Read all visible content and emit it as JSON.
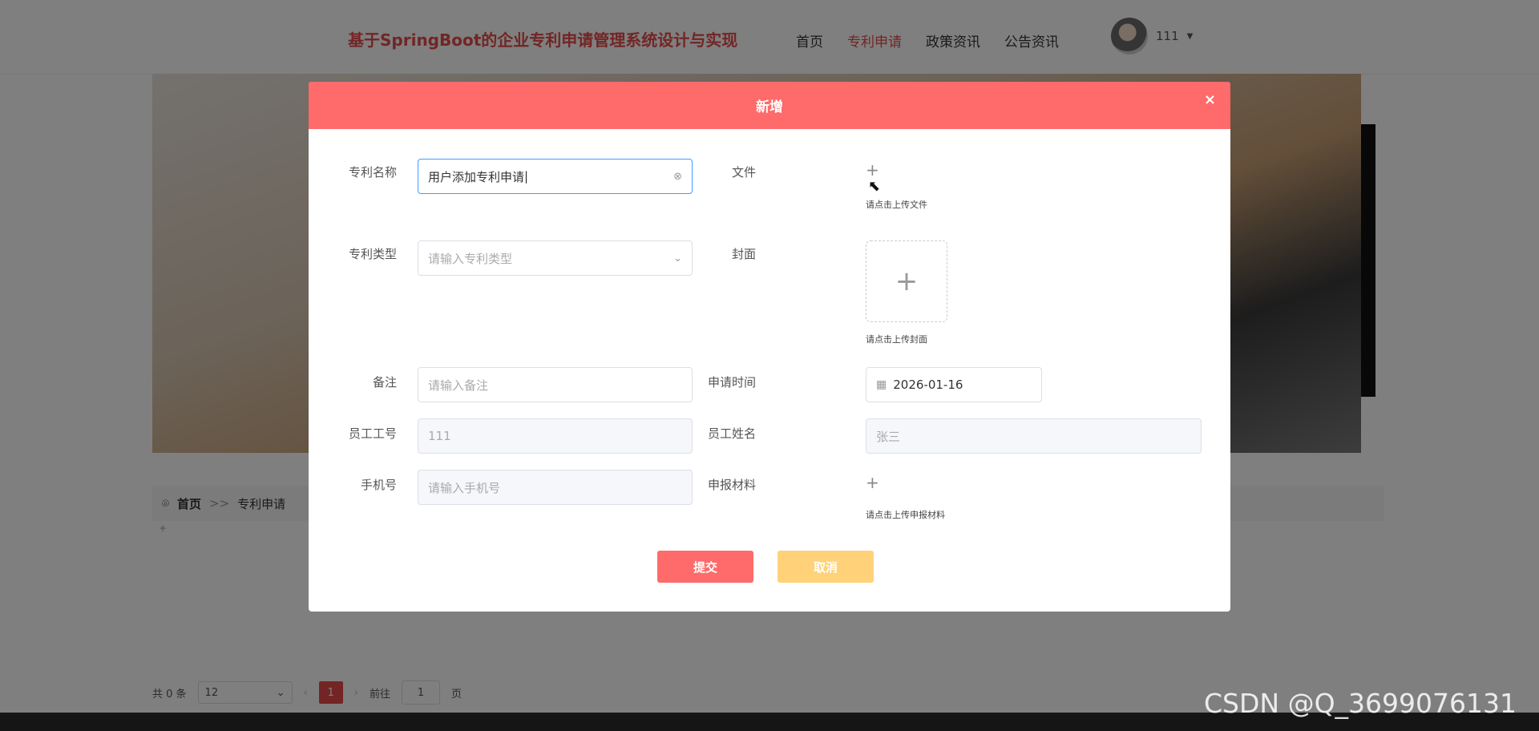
{
  "site": {
    "title": "基于SpringBoot的企业专利申请管理系统设计与实现",
    "nav": [
      "首页",
      "专利申请",
      "政策资讯",
      "公告资讯"
    ],
    "active_nav": "专利申请",
    "user": "111"
  },
  "breadcrumb": {
    "home": "首页",
    "sep": ">>",
    "current": "专利申请"
  },
  "pagination": {
    "total": "共 0 条",
    "page_size": "12",
    "current_page": "1",
    "goto_label": "前往",
    "goto_value": "1",
    "page_suffix": "页"
  },
  "dialog": {
    "title": "新增",
    "close": "×",
    "fields": {
      "name": {
        "label": "专利名称",
        "value": "用户添加专利申请"
      },
      "file": {
        "label": "文件",
        "hint": "请点击上传文件"
      },
      "type": {
        "label": "专利类型",
        "placeholder": "请输入专利类型"
      },
      "cover": {
        "label": "封面",
        "hint": "请点击上传封面"
      },
      "remark": {
        "label": "备注",
        "placeholder": "请输入备注"
      },
      "apply_time": {
        "label": "申请时间",
        "value": "2026-01-16"
      },
      "emp_no": {
        "label": "员工工号",
        "value": "111"
      },
      "emp_name": {
        "label": "员工姓名",
        "value": "张三"
      },
      "phone": {
        "label": "手机号",
        "placeholder": "请输入手机号"
      },
      "material": {
        "label": "申报材料",
        "hint": "请点击上传申报材料"
      }
    },
    "buttons": {
      "submit": "提交",
      "cancel": "取消"
    }
  },
  "watermark": "CSDN @Q_3699076131",
  "colors": {
    "accent": "#e64a4a",
    "header": "#ff6a6a",
    "cancel": "#ffd27a",
    "focus": "#409eff"
  }
}
